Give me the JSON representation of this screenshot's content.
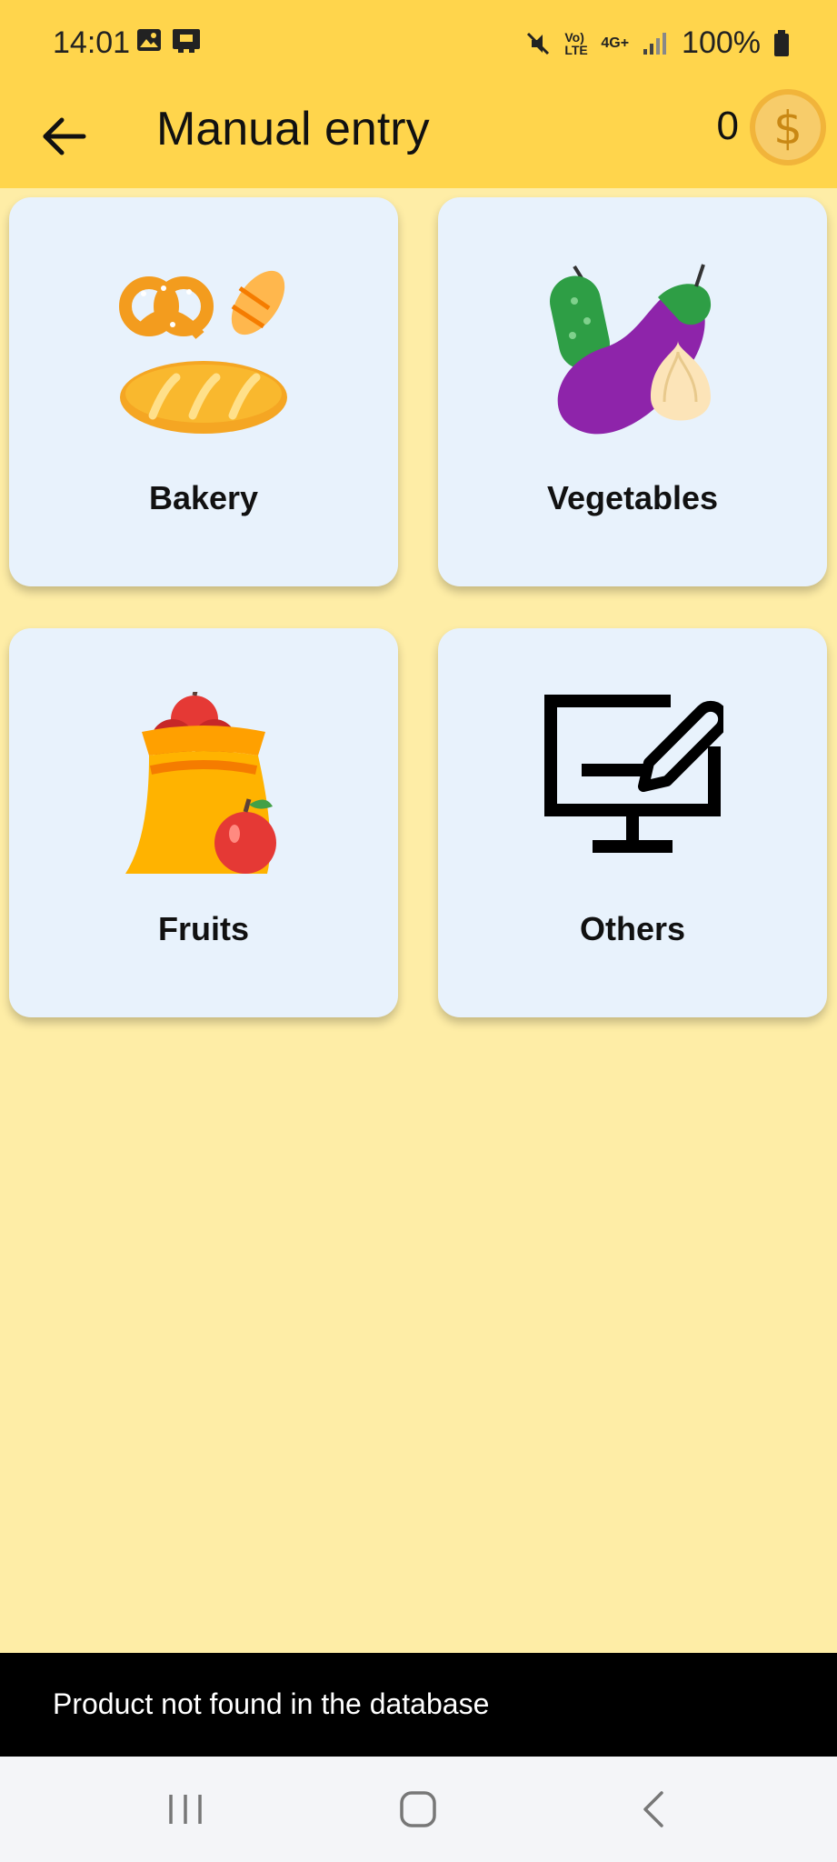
{
  "status_bar": {
    "time": "14:01",
    "battery_text": "100%",
    "left_icons": [
      "image-icon",
      "sim-card-icon"
    ],
    "right_icons": [
      "mute-icon",
      "volte-icon",
      "4g-data-icon",
      "signal-icon",
      "battery-icon"
    ],
    "volte_label": "Vo) LTE",
    "network_label": "4G+"
  },
  "app_bar": {
    "title": "Manual entry",
    "coin_count": "0",
    "back_icon": "arrow-left-icon",
    "coin_icon": "dollar-coin-icon",
    "background": "#FFD54C"
  },
  "categories": [
    {
      "label": "Bakery",
      "icon": "bakery-icon"
    },
    {
      "label": "Vegetables",
      "icon": "vegetables-icon"
    },
    {
      "label": "Fruits",
      "icon": "fruits-icon"
    },
    {
      "label": "Others",
      "icon": "monitor-edit-icon"
    }
  ],
  "snackbar": {
    "message": "Product not found in the database"
  },
  "nav_bar": {
    "buttons": [
      "recent-apps-icon",
      "home-icon",
      "back-icon"
    ]
  },
  "colors": {
    "page_background": "#FEEDA6",
    "card_background": "#E8F2FC",
    "accent": "#FFD54C"
  }
}
